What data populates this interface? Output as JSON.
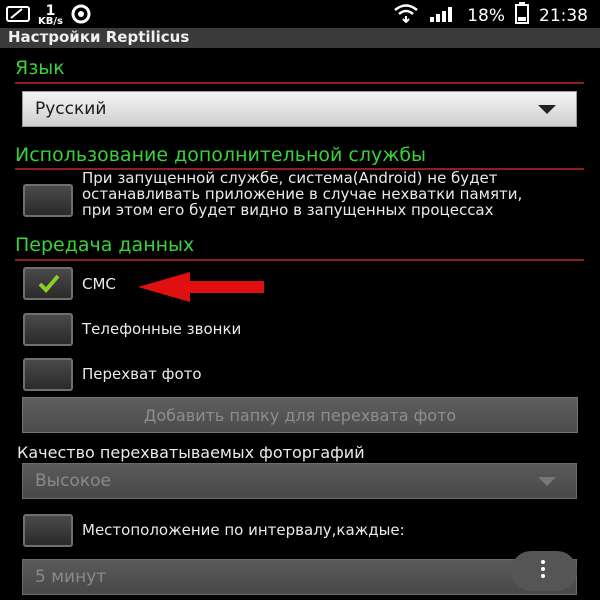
{
  "status_bar": {
    "speed_value": "1",
    "speed_unit": "KB/s",
    "battery": "18%",
    "time": "21:38",
    "icons": [
      "notification-icon",
      "sync-icon",
      "wifi-icon",
      "signal-icon",
      "battery-icon"
    ]
  },
  "title": "Настройки Reptilicus",
  "sections": {
    "language": {
      "header": "Язык",
      "selected": "Русский"
    },
    "extra_service": {
      "header": "Использование дополнительной службы",
      "checkbox_label": "При запущенной службе, система(Android) не будет останавливать приложение в случае нехватки памяти, при этом его будет видно в запущенных процессах",
      "checked": false
    },
    "data_transfer": {
      "header": "Передача данных",
      "sms_label": "СМС",
      "sms_checked": true,
      "calls_label": "Телефонные звонки",
      "calls_checked": false,
      "photo_label": "Перехват фото",
      "photo_checked": false,
      "add_folder_button": "Добавить папку для перехвата фото",
      "quality_label": "Качество перехватываемых фоторгафий",
      "quality_selected": "Высокое",
      "location_label": "Местоположение по интервалу,каждые:",
      "location_checked": false,
      "interval_selected": "5 минут"
    }
  },
  "colors": {
    "section_header": "#39d23a",
    "divider": "#8c1f1f",
    "checkmark": "#8ccd2b",
    "annotation_arrow": "#e01010"
  }
}
